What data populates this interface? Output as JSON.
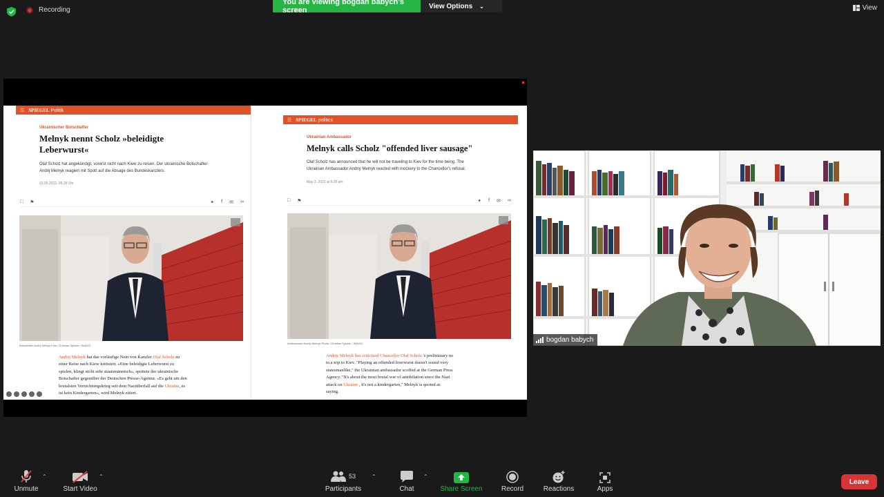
{
  "meeting": {
    "recording_label": "Recording",
    "banner_text": "You are viewing bogdan babych's screen",
    "view_options_label": "View Options",
    "view_label": "View"
  },
  "article_de": {
    "brand": "SPIEGEL",
    "section": "Politik",
    "kicker": "Ukrainischer Botschafter",
    "headline_1": "Melnyk nennt Scholz »beleidigte",
    "headline_2": "Leberwurst«",
    "teaser_1": "Olaf Scholz hat angekündigt, vorerst nicht nach Kiew zu reisen. Der ukrainische Botschafter",
    "teaser_2": "Andrij Melnyk reagiert mit Spott auf die Absage des Bundeskanzlers.",
    "date": "03.05.2022, 06.28 Uhr",
    "caption": "Botschafter Andrij Melnyk  Foto: Christian Spicker / IMAGO",
    "body_1a": "Andrij Melnyk",
    "body_1b": " hat das vorläufige Nein von Kanzler ",
    "body_1c": "Olaf Scholz",
    "body_1d": " zu",
    "body_2": "einer Reise nach Kiew kritisiert. »Eine beleidigte Leberwurst zu",
    "body_3": "spielen, klingt nicht sehr staatsmännisch«, spottete der ukrainische",
    "body_4": "Botschafter gegenüber der Deutschen Presse-Agentur. »Es geht um den",
    "body_5a": "brutalsten Vernichtungskrieg seit dem Naziüberfall auf die ",
    "body_5b": "Ukraine",
    "body_5c": ", es",
    "body_6": "ist kein Kindergarten«, wird Melnyk zitiert."
  },
  "article_en": {
    "brand": "SPIEGEL",
    "section": "politics",
    "kicker": "Ukrainian Ambassador",
    "headline": "Melnyk calls Scholz \"offended liver sausage\"",
    "teaser_1": "Olaf Scholz has announced that he will not be traveling to Kiev for the time being. The",
    "teaser_2": "Ukrainian Ambassador Andriy Melnyk reacted with mockery to the Chancellor's refusal.",
    "date": "May 3, 2022 at 6:28 am",
    "caption": "Ambassador Andriy Melnyk  Photo: Christian Spicker / IMAGO",
    "body_1a": "Andriy Melnyk has criticized Chancellor ",
    "body_1b": "Olaf Scholz",
    "body_1c": " 's preliminary no",
    "body_2": "to a trip to Kiev. \"Playing an offended liverwurst doesn't sound very",
    "body_3": "statesmanlike,\" the Ukrainian ambassador scoffed at the German Press",
    "body_4": "Agency. \"It's about the most brutal war of annihilation since the Nazi",
    "body_5a": "attack on ",
    "body_5b": "Ukraine",
    "body_5c": " , it's not a kindergarten,\" Melnyk is quoted as",
    "body_6": "saying."
  },
  "video": {
    "participant_name": "bogdan babych"
  },
  "toolbar": {
    "unmute": "Unmute",
    "start_video": "Start Video",
    "participants": "Participants",
    "participant_count": "53",
    "chat": "Chat",
    "share_screen": "Share Screen",
    "record": "Record",
    "reactions": "Reactions",
    "apps": "Apps",
    "leave": "Leave"
  },
  "colors": {
    "accent_green": "#24b544",
    "spiegel_orange": "#e0532a",
    "leave_red": "#d73535"
  }
}
